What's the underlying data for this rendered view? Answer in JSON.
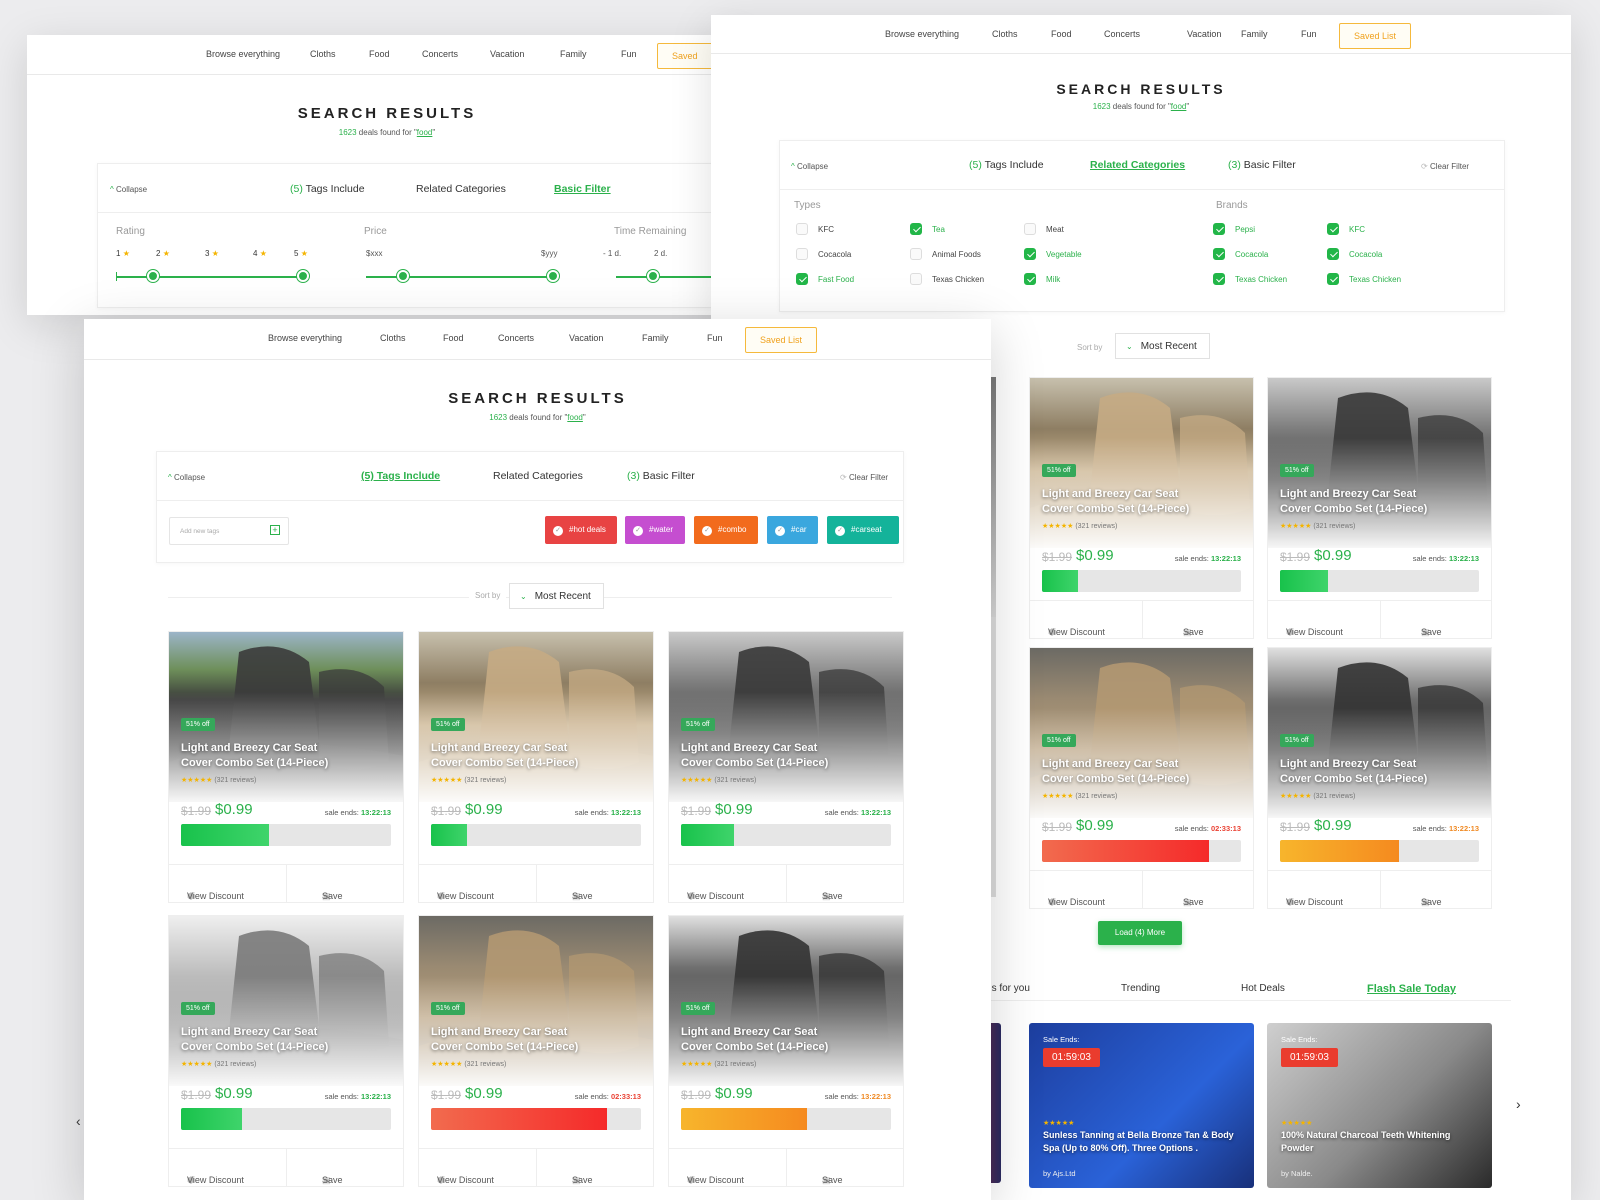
{
  "nav": {
    "browse": "Browse everything",
    "cloths": "Cloths",
    "food": "Food",
    "concerts": "Concerts",
    "vacation": "Vacation",
    "family": "Family",
    "fun": "Fun",
    "saved": "Saved List",
    "saved_cut": "Saved"
  },
  "search": {
    "title": "SEARCH RESULTS",
    "count": "1623",
    "mid": " deals found for \"",
    "query": "food",
    "end": "\""
  },
  "filter": {
    "collapse": "Collapse",
    "tags_count": "(5)",
    "tags_label": "Tags Include",
    "related": "Related Categories",
    "basic_count": "(3)",
    "basic_label": "Basic Filter",
    "basic_plain": "Basic Filter",
    "clear": "Clear Filter",
    "tags_active": "(5) Tags Include"
  },
  "basic": {
    "rating": "Rating",
    "r1": "1",
    "r2": "2",
    "r3": "3",
    "r4": "4",
    "r5": "5",
    "price": "Price",
    "pmin": "$xxx",
    "pmax": "$yyy",
    "time": "Time Remaining",
    "t1": "- 1 d.",
    "t2": "2 d."
  },
  "types": {
    "label": "Types",
    "items": [
      {
        "name": "KFC",
        "on": false
      },
      {
        "name": "Tea",
        "on": true
      },
      {
        "name": "Meat",
        "on": false
      },
      {
        "name": "Cocacola",
        "on": false
      },
      {
        "name": "Animal Foods",
        "on": false
      },
      {
        "name": "Vegetable",
        "on": true
      },
      {
        "name": "Fast Food",
        "on": true
      },
      {
        "name": "Texas Chicken",
        "on": false
      },
      {
        "name": "Milk",
        "on": true
      }
    ]
  },
  "brands": {
    "label": "Brands",
    "items": [
      {
        "name": "Pepsi",
        "on": true
      },
      {
        "name": "KFC",
        "on": true
      },
      {
        "name": "Cocacola",
        "on": true
      },
      {
        "name": "Cocacola",
        "on": true
      },
      {
        "name": "Texas Chicken",
        "on": true
      },
      {
        "name": "Texas Chicken",
        "on": true
      }
    ]
  },
  "tags": {
    "placeholder": "Add new tags",
    "items": [
      {
        "label": "#hot deals",
        "color": "#e84343"
      },
      {
        "label": "#water",
        "color": "#c54ed0"
      },
      {
        "label": "#combo",
        "color": "#f26b1d"
      },
      {
        "label": "#car",
        "color": "#3aa7de"
      },
      {
        "label": "#carseat",
        "color": "#14b39a"
      }
    ]
  },
  "sort": {
    "label": "Sort by",
    "value": "Most Recent"
  },
  "product": {
    "badge": "51% off",
    "title": "Light and Breezy Car Seat Cover Combo Set (14-Piece)",
    "stars": "★★★★★",
    "reviews": " (321 reviews)",
    "old_price": "$1.99",
    "price": "$0.99",
    "sale_label": "sale ends: ",
    "view": "View Discount",
    "save": "Save"
  },
  "cards_front": [
    {
      "time": "13:22:13",
      "progress": 0.42,
      "color": "g"
    },
    {
      "time": "13:22:13",
      "progress": 0.17,
      "color": "g"
    },
    {
      "time": "13:22:13",
      "progress": 0.25,
      "color": "g"
    },
    {
      "time": "13:22:13",
      "progress": 0.29,
      "color": "g"
    },
    {
      "time": "02:33:13",
      "progress": 0.84,
      "color": "r"
    },
    {
      "time": "13:22:13",
      "progress": 0.6,
      "color": "o"
    }
  ],
  "cards_back": [
    {
      "time": "13:22:13",
      "progress": 0.18,
      "color": "g"
    },
    {
      "time": "13:22:13",
      "progress": 0.24,
      "color": "g"
    },
    {
      "time": "02:33:13",
      "progress": 0.84,
      "color": "r"
    },
    {
      "time": "13:22:13",
      "progress": 0.6,
      "color": "o"
    }
  ],
  "partial_time": "13",
  "load_more": "Load (4) More",
  "tabs": {
    "deals": "Deals for you",
    "trending": "Trending",
    "hot": "Hot Deals",
    "flash": "Flash Sale Today"
  },
  "flash": [
    {
      "ends": "Sale Ends:",
      "timer": "01:59:03",
      "title": "Sunless Tanning at Bella Bronze Tan & Body Spa (Up to 80% Off). Three Options .",
      "by": "by Ajs.Ltd"
    },
    {
      "ends": "Sale Ends:",
      "timer": "01:59:03",
      "title": "100% Natural Charcoal Teeth Whitening Powder",
      "by": "by Nalde."
    }
  ],
  "colors": {
    "accent": "#2bb14b",
    "saved": "#f0a21e"
  }
}
